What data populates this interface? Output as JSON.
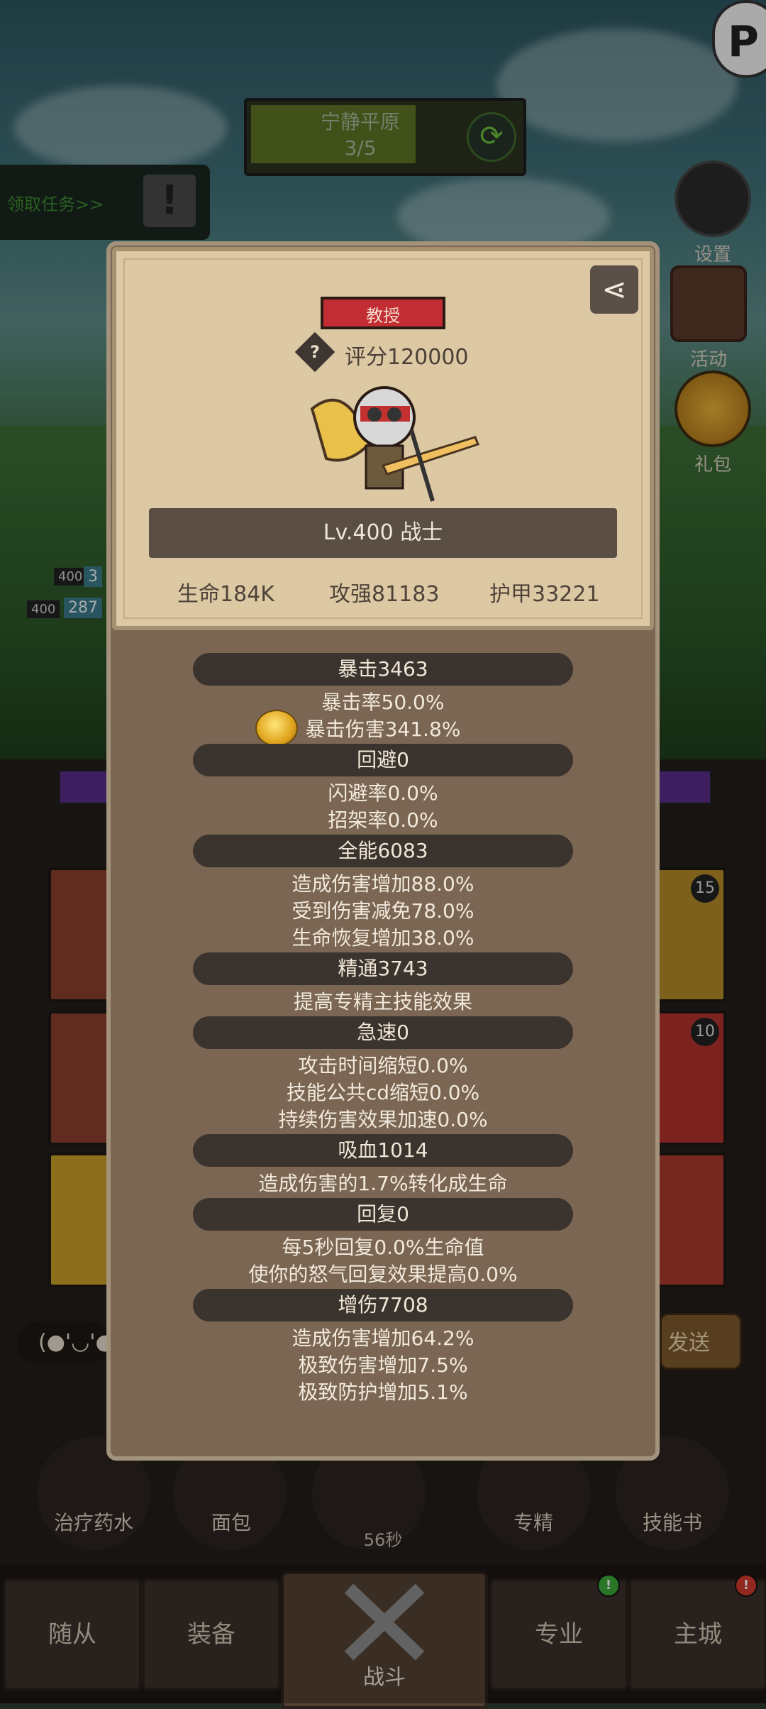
{
  "background": {
    "stage": {
      "name": "宁静平原",
      "progress": "3/5",
      "fill_fraction": 0.6
    },
    "quest": {
      "label": "领取任务>>"
    },
    "side_buttons": [
      {
        "label": "设置",
        "icon": "gear-icon"
      },
      {
        "label": "活动",
        "icon": "calendar-icon"
      },
      {
        "label": "礼包",
        "icon": "gift-bag-icon"
      }
    ],
    "hero_levels": [
      "400",
      "400"
    ],
    "hero_values": [
      "3",
      "287"
    ],
    "slot_counts": [
      "15",
      "10"
    ],
    "chat": {
      "emoticon": "(●'◡'●"
    },
    "send_label": "发送",
    "tools": [
      {
        "label": "治疗药水",
        "icon": "potion-icon"
      },
      {
        "label": "面包",
        "icon": "bread-icon"
      },
      {
        "label": "",
        "icon": "chest-icon"
      },
      {
        "label": "专精",
        "icon": "spiral-icon"
      },
      {
        "label": "技能书",
        "icon": "book-icon"
      }
    ],
    "timer": "56秒",
    "nav": [
      {
        "label": "随从"
      },
      {
        "label": "装备"
      },
      {
        "label": "战斗"
      },
      {
        "label": "专业"
      },
      {
        "label": "主城"
      }
    ],
    "badges": {
      "profession": "!",
      "city": "!"
    }
  },
  "panel": {
    "title": "教授",
    "score": "评分120000",
    "level_class": "Lv.400 战士",
    "stats": {
      "hp": "生命184K",
      "attack": "攻强81183",
      "armor": "护甲33221"
    },
    "sections": [
      {
        "header": "暴击3463",
        "lines": [
          "暴击率50.0%",
          "暴击伤害341.8%"
        ]
      },
      {
        "header": "回避0",
        "lines": [
          "闪避率0.0%",
          "招架率0.0%"
        ]
      },
      {
        "header": "全能6083",
        "lines": [
          "造成伤害增加88.0%",
          "受到伤害减免78.0%",
          "生命恢复增加38.0%"
        ]
      },
      {
        "header": "精通3743",
        "lines": [
          "提高专精主技能效果"
        ]
      },
      {
        "header": "急速0",
        "lines": [
          "攻击时间缩短0.0%",
          "技能公共cd缩短0.0%",
          "持续伤害效果加速0.0%"
        ]
      },
      {
        "header": "吸血1014",
        "lines": [
          "造成伤害的1.7%转化成生命"
        ]
      },
      {
        "header": "回复0",
        "lines": [
          "每5秒回复0.0%生命值",
          "使你的怒气回复效果提高0.0%"
        ]
      },
      {
        "header": "增伤7708",
        "lines": [
          "造成伤害增加64.2%",
          "极致伤害增加7.5%",
          "极致防护增加5.1%"
        ]
      }
    ]
  }
}
